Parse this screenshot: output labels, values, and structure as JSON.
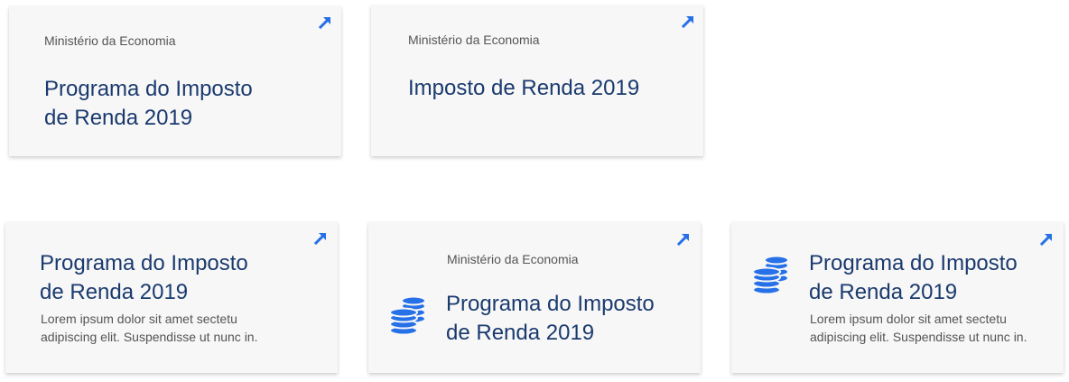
{
  "colors": {
    "accent": "#2670e8",
    "title": "#1a3a6e",
    "text": "#555555",
    "card_bg": "#f7f7f7"
  },
  "icons": {
    "external_link": "arrow-up-right-icon",
    "coins": "coins-icon"
  },
  "cards": [
    {
      "org": "Ministério da Economia",
      "title_line1": "Programa do Imposto",
      "title_line2": "de Renda 2019"
    },
    {
      "org": "Ministério da Economia",
      "title_line1": "Imposto de Renda 2019"
    },
    {
      "title_line1": "Programa do Imposto",
      "title_line2": "de Renda 2019",
      "desc_line1": "Lorem ipsum dolor sit amet sectetu",
      "desc_line2": "adipiscing elit. Suspendisse ut nunc in."
    },
    {
      "org": "Ministério da Economia",
      "title_line1": "Programa do Imposto",
      "title_line2": "de Renda 2019"
    },
    {
      "title_line1": "Programa do Imposto",
      "title_line2": "de Renda 2019",
      "desc_line1": "Lorem ipsum dolor sit amet sectetu",
      "desc_line2": "adipiscing elit. Suspendisse ut nunc in."
    }
  ]
}
